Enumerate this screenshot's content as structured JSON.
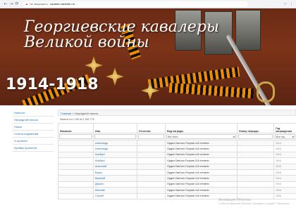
{
  "browser": {
    "back_icon": "arrow-left-icon",
    "forward_icon": "arrow-right-icon",
    "reload_icon": "reload-icon",
    "security_label": "Не защищено",
    "url": "cavalier.nasledie.ru/..."
  },
  "banner": {
    "title_line1": "Георгиевские кавалеры",
    "title_line2": "Великой войны",
    "years": "1914-1918"
  },
  "sidebar": {
    "items": [
      {
        "label": "Новости"
      },
      {
        "label": "Наградной список"
      },
      {
        "label": "Поиск"
      },
      {
        "label": "Статьи подлинной"
      },
      {
        "label": "О проекте"
      },
      {
        "label": "Архивы проектов"
      }
    ]
  },
  "main": {
    "breadcrumb": {
      "home": "Главная",
      "separator": "»",
      "current": "Наградной список"
    },
    "records_info": "Записи со 1-100 из 1,262 775",
    "columns": [
      "Фамилия",
      "Имя",
      "Отчество",
      "Вид награды",
      "Номер награды",
      "Год награждения"
    ],
    "filters": {
      "award_select": "Все типы",
      "year_select": "Все год"
    },
    "rows": [
      {
        "surname": "",
        "name": "Александр",
        "patronymic": "",
        "award": "Орден Святого Георгия 4-й степени",
        "number": "",
        "year": "1914"
      },
      {
        "surname": "",
        "name": "Александр",
        "patronymic": "",
        "award": "Орден Святого Георгия 4-й степени",
        "number": "",
        "year": "1914"
      },
      {
        "surname": "",
        "name": "Альберт",
        "patronymic": "",
        "award": "Орден Святого Георгия 4-й степени",
        "number": "",
        "year": "1914"
      },
      {
        "surname": "",
        "name": "Альберт",
        "patronymic": "",
        "award": "Орден Святого Георгия 3-й степени",
        "number": "",
        "year": "1914"
      },
      {
        "surname": "",
        "name": "Анатолий",
        "patronymic": "",
        "award": "Орден Святого Георгия 4-й степени",
        "number": "",
        "year": "1915"
      },
      {
        "surname": "",
        "name": "Борис",
        "patronymic": "",
        "award": "Орден Святого Георгия 4-й степени",
        "number": "",
        "year": "1915"
      },
      {
        "surname": "",
        "name": "Василий",
        "patronymic": "",
        "award": "Орден Святого Георгия 4-й степени",
        "number": "",
        "year": "1914"
      },
      {
        "surname": "",
        "name": "Даниил",
        "patronymic": "",
        "award": "Орден Святого Георгия 4-й степени",
        "number": "",
        "year": "1914"
      },
      {
        "surname": "",
        "name": "Евгений",
        "patronymic": "",
        "award": "Орден Святого Георгия 4-й степени",
        "number": "",
        "year": "1916"
      },
      {
        "surname": "",
        "name": "Сергей",
        "patronymic": "",
        "award": "Орден Святого Георгия 4-й степени",
        "number": "",
        "year": "1916"
      }
    ]
  },
  "watermark": {
    "line1": "Активация Windows",
    "line2": "Чтобы активировать Windows, перейдите в раздел \"Параметры\"."
  },
  "colors": {
    "banner_bg": "#7d3419",
    "link": "#1a6fb4"
  }
}
